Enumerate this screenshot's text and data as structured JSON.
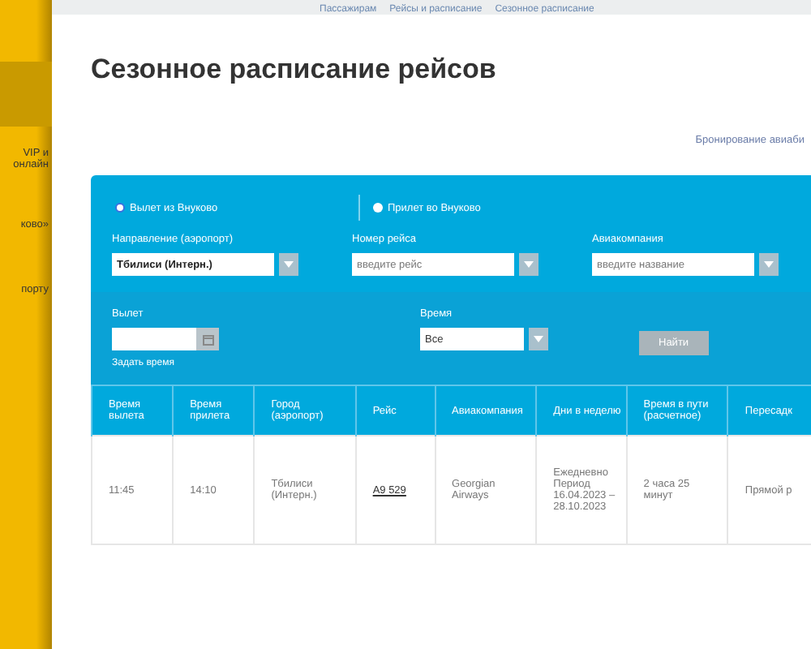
{
  "breadcrumb": [
    "Пассажирам",
    "Рейсы и расписание",
    "Сезонное расписание"
  ],
  "sidebar": {
    "items": [
      {
        "selected": true
      },
      {
        "label": "VIP и\nонлайн",
        "selected": false
      },
      {
        "label": "ково»",
        "selected": false
      },
      {
        "label": "порту",
        "selected": false
      }
    ]
  },
  "title": "Сезонное расписание рейсов",
  "booking_link": "Бронирование авиаби",
  "direction": [
    {
      "label": "Вылет из Внуково",
      "selected": true
    },
    {
      "label": "Прилет во Внуково",
      "selected": false
    }
  ],
  "filters": [
    {
      "label": "Направление (аэропорт)",
      "value": "Тбилиси (Интерн.)"
    },
    {
      "label": "Номер рейса",
      "placeholder": "введите рейс"
    },
    {
      "label": "Авиакомпания",
      "placeholder": "введите название"
    }
  ],
  "departure": {
    "label": "Вылет",
    "link": "Задать время"
  },
  "time": {
    "label": "Время",
    "value": "Все"
  },
  "search_button": "Найти",
  "table": {
    "columns": [
      "Время вылета",
      "Время прилета",
      "Город (аэропорт)",
      "Рейс",
      "Авиакомпания",
      "Дни в неделю",
      "Время в пути (расчетное)",
      "Пересадк"
    ],
    "rows": [
      [
        "11:45",
        "14:10",
        "Тбилиси (Интерн.)",
        "A9 529",
        "Georgian Airways",
        "Ежедневно Период 16.04.2023 – 28.10.2023",
        "2 часа 25 минут",
        "Прямой р"
      ]
    ]
  }
}
